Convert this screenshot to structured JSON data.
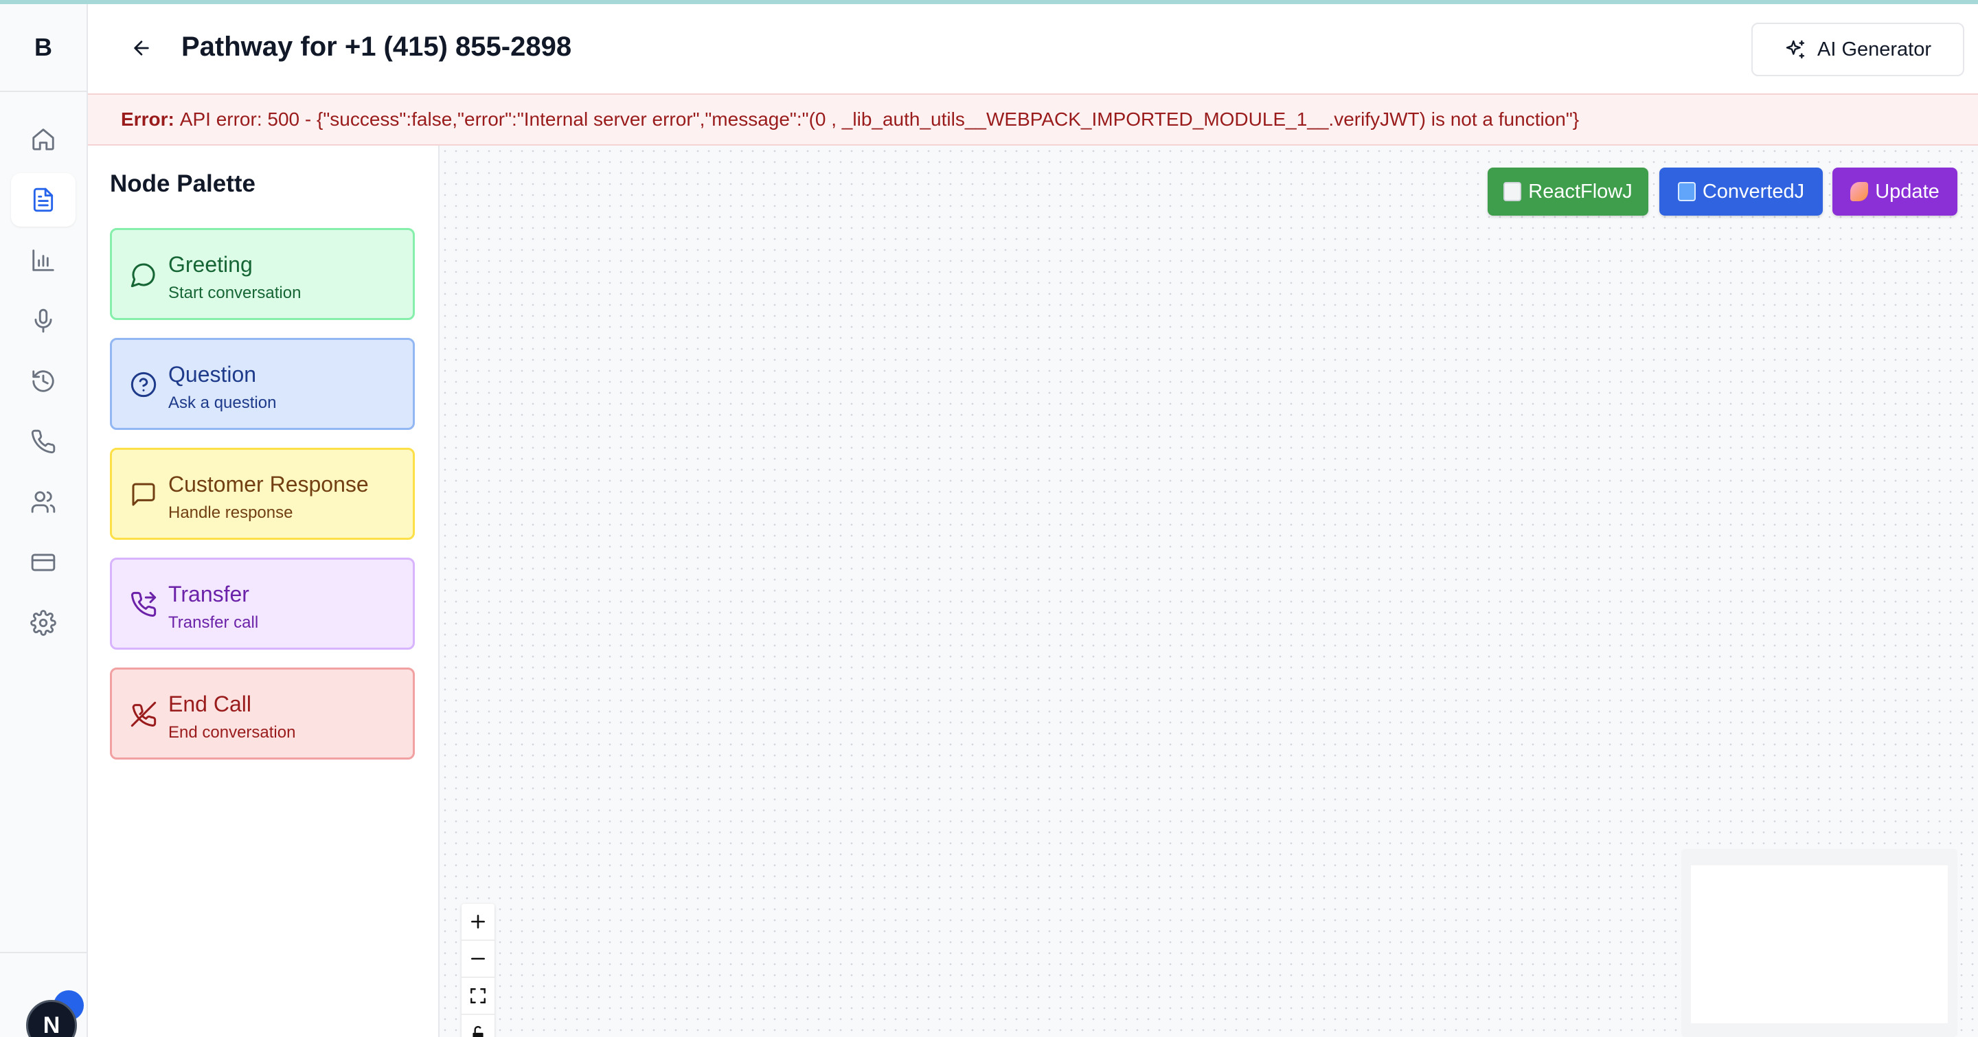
{
  "app": {
    "brand": "B",
    "avatar_initial": "N"
  },
  "header": {
    "title": "Pathway for +1 (415) 855-2898",
    "ai_button_label": "AI Generator"
  },
  "error": {
    "prefix": "Error:",
    "message": "API error: 500 - {\"success\":false,\"error\":\"Internal server error\",\"message\":\"(0 , _lib_auth_utils__WEBPACK_IMPORTED_MODULE_1__.verifyJWT) is not a function\"}"
  },
  "sidebar": {
    "items": [
      {
        "icon": "home-icon"
      },
      {
        "icon": "document-icon",
        "active": true
      },
      {
        "icon": "bar-chart-icon"
      },
      {
        "icon": "microphone-icon"
      },
      {
        "icon": "history-icon"
      },
      {
        "icon": "phone-icon"
      },
      {
        "icon": "users-icon"
      },
      {
        "icon": "credit-card-icon"
      },
      {
        "icon": "settings-icon"
      }
    ]
  },
  "palette": {
    "title": "Node Palette",
    "nodes": [
      {
        "label": "Greeting",
        "sub": "Start conversation",
        "icon": "message-circle-icon",
        "color": "#dcfce7"
      },
      {
        "label": "Question",
        "sub": "Ask a question",
        "icon": "help-circle-icon",
        "color": "#dbe7fc"
      },
      {
        "label": "Customer Response",
        "sub": "Handle response",
        "icon": "message-square-icon",
        "color": "#fef9c3"
      },
      {
        "label": "Transfer",
        "sub": "Transfer call",
        "icon": "phone-forwarded-icon",
        "color": "#f3e8ff"
      },
      {
        "label": "End Call",
        "sub": "End conversation",
        "icon": "phone-off-icon",
        "color": "#fde2e2"
      }
    ]
  },
  "canvas": {
    "buttons": [
      {
        "label": "ReactFlowJ",
        "color": "#3f9e4c",
        "icon": "page-emoji"
      },
      {
        "label": "ConvertedJ",
        "color": "#2f63e0",
        "icon": "arrows-emoji"
      },
      {
        "label": "Update",
        "color": "#8b2fd6",
        "icon": "rocket-emoji"
      }
    ]
  }
}
